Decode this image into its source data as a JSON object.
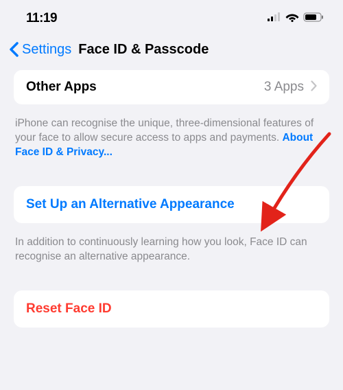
{
  "status": {
    "time": "11:19"
  },
  "nav": {
    "back_label": "Settings",
    "title": "Face ID & Passcode"
  },
  "other_apps": {
    "label": "Other Apps",
    "value": "3 Apps"
  },
  "footer1": {
    "text": "iPhone can recognise the unique, three-dimensional features of your face to allow secure access to apps and payments. ",
    "link": "About Face ID & Privacy..."
  },
  "alt_appearance": {
    "label": "Set Up an Alternative Appearance"
  },
  "footer2": {
    "text": "In addition to continuously learning how you look, Face ID can recognise an alternative appearance."
  },
  "reset": {
    "label": "Reset Face ID"
  }
}
